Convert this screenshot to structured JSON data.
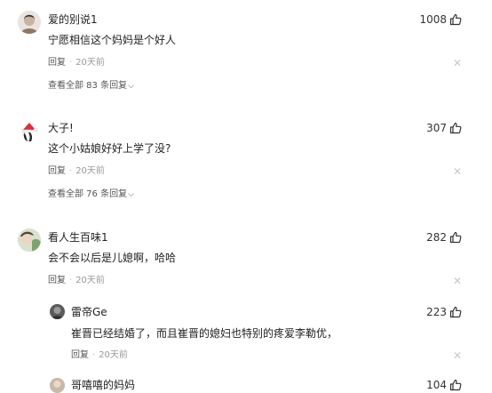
{
  "comments": [
    {
      "username": "爱的别说1",
      "text": "宁愿相信这个妈妈是个好人",
      "likes": "1008",
      "reply_label": "回复",
      "time": "20天前",
      "view_all": "查看全部 83 条回复"
    },
    {
      "username": "大子!",
      "text": "这个小姑娘好好上学了没?",
      "likes": "307",
      "reply_label": "回复",
      "time": "20天前",
      "view_all": "查看全部 76 条回复"
    },
    {
      "username": "看人生百味1",
      "text": "会不会以后是儿媳啊，哈哈",
      "likes": "282",
      "reply_label": "回复",
      "time": "20天前"
    }
  ],
  "replies": [
    {
      "username": "雷帝Ge",
      "text": "崔晋已经结婚了，而且崔晋的媳妇也特别的疼爱李勒优，",
      "likes": "223",
      "reply_label": "回复",
      "time": "20天前"
    },
    {
      "username": "哥嘻嘻的妈妈",
      "likes": "104"
    }
  ],
  "icons": {
    "like": "thumbs-up-icon",
    "close": "close-icon",
    "expand": "chevron-down-icon"
  }
}
